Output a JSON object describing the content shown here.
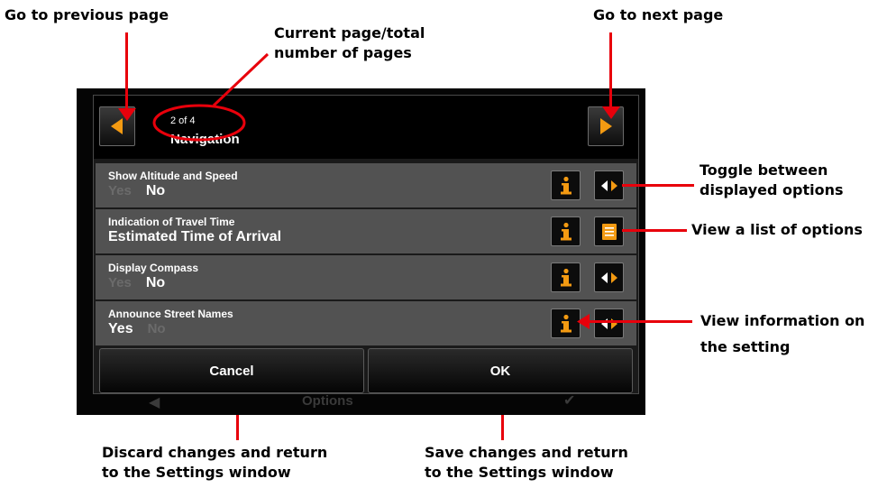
{
  "callouts": {
    "prev_page": "Go to previous page",
    "page_count_line1": "Current page/total",
    "page_count_line2": "number of pages",
    "next_page": "Go to next page",
    "toggle_line1": "Toggle between",
    "toggle_line2": "displayed options",
    "list_options": "View a list of options",
    "info_line1": "View information on",
    "info_line2": "the setting",
    "discard_line1": "Discard changes and return",
    "discard_line2": "to the Settings window",
    "save_line1": "Save changes and return",
    "save_line2": "to the Settings window"
  },
  "device": {
    "background_label": "Options"
  },
  "header": {
    "page_indicator": "2 of 4",
    "title": "Navigation"
  },
  "settings": [
    {
      "label": "Show Altitude and Speed",
      "dim_value": "Yes",
      "value": "No",
      "control": "toggle"
    },
    {
      "label": "Indication of Travel Time",
      "dim_value": "",
      "value": "Estimated Time of Arrival",
      "control": "list"
    },
    {
      "label": "Display Compass",
      "dim_value": "Yes",
      "value": "No",
      "control": "toggle"
    },
    {
      "label": "Announce Street Names",
      "value": "Yes",
      "dim_value": "No",
      "control": "toggle"
    }
  ],
  "buttons": {
    "cancel": "Cancel",
    "ok": "OK"
  },
  "colors": {
    "accent_orange": "#f39a12",
    "callout_red": "#e8000b",
    "row_gray": "#525252"
  }
}
